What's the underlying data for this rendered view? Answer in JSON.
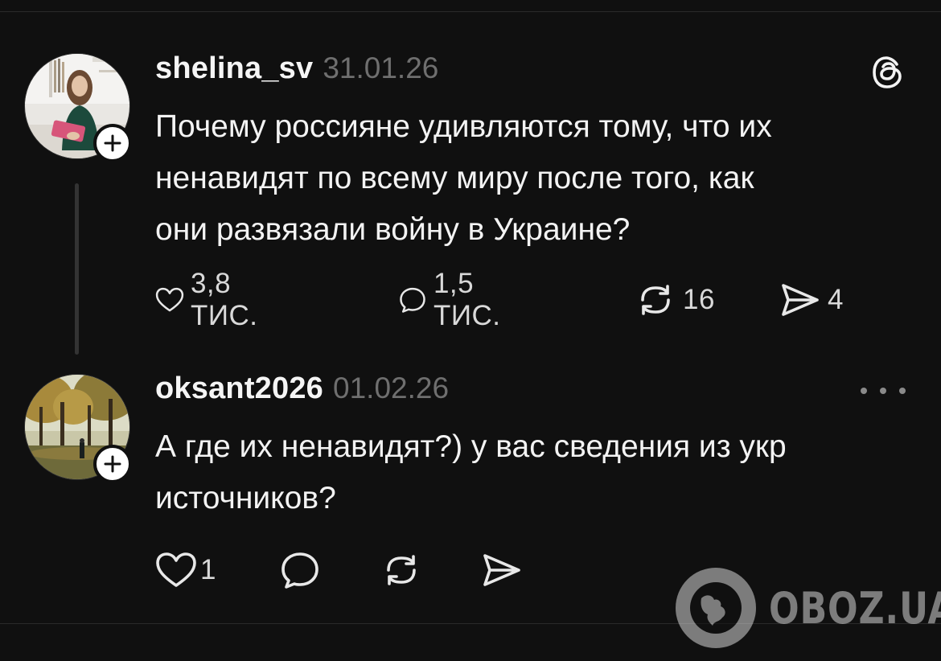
{
  "posts": [
    {
      "username": "shelina_sv",
      "date": "31.01.26",
      "avatar": "woman-reading-library-photo",
      "text_lines": [
        "Почему россияне удивляются тому, что их",
        "ненавидят по всему миру после того, как",
        "они развязали войну в Украине?"
      ],
      "actions": {
        "likes": "3,8 ТИС.",
        "replies": "1,5 ТИС.",
        "reposts": "16",
        "shares": "4"
      }
    },
    {
      "username": "oksant2026",
      "date": "01.02.26",
      "avatar": "autumn-park-photo",
      "text_lines": [
        "А где их ненавидят?) у вас сведения из укр",
        "источников?"
      ],
      "actions": {
        "likes": "1"
      }
    }
  ],
  "icons": {
    "like": "heart-icon",
    "reply": "comment-bubble-icon",
    "repost": "repost-icon",
    "share": "send-icon",
    "brand": "threads-logo-icon",
    "more": "more-dots-icon",
    "follow": "plus-icon"
  },
  "watermark": {
    "text": "OBOZ.UA"
  },
  "colors": {
    "background": "#101010",
    "text": "#f3f3f3",
    "muted": "#6f6f6f",
    "divider": "#2a2a2a"
  }
}
